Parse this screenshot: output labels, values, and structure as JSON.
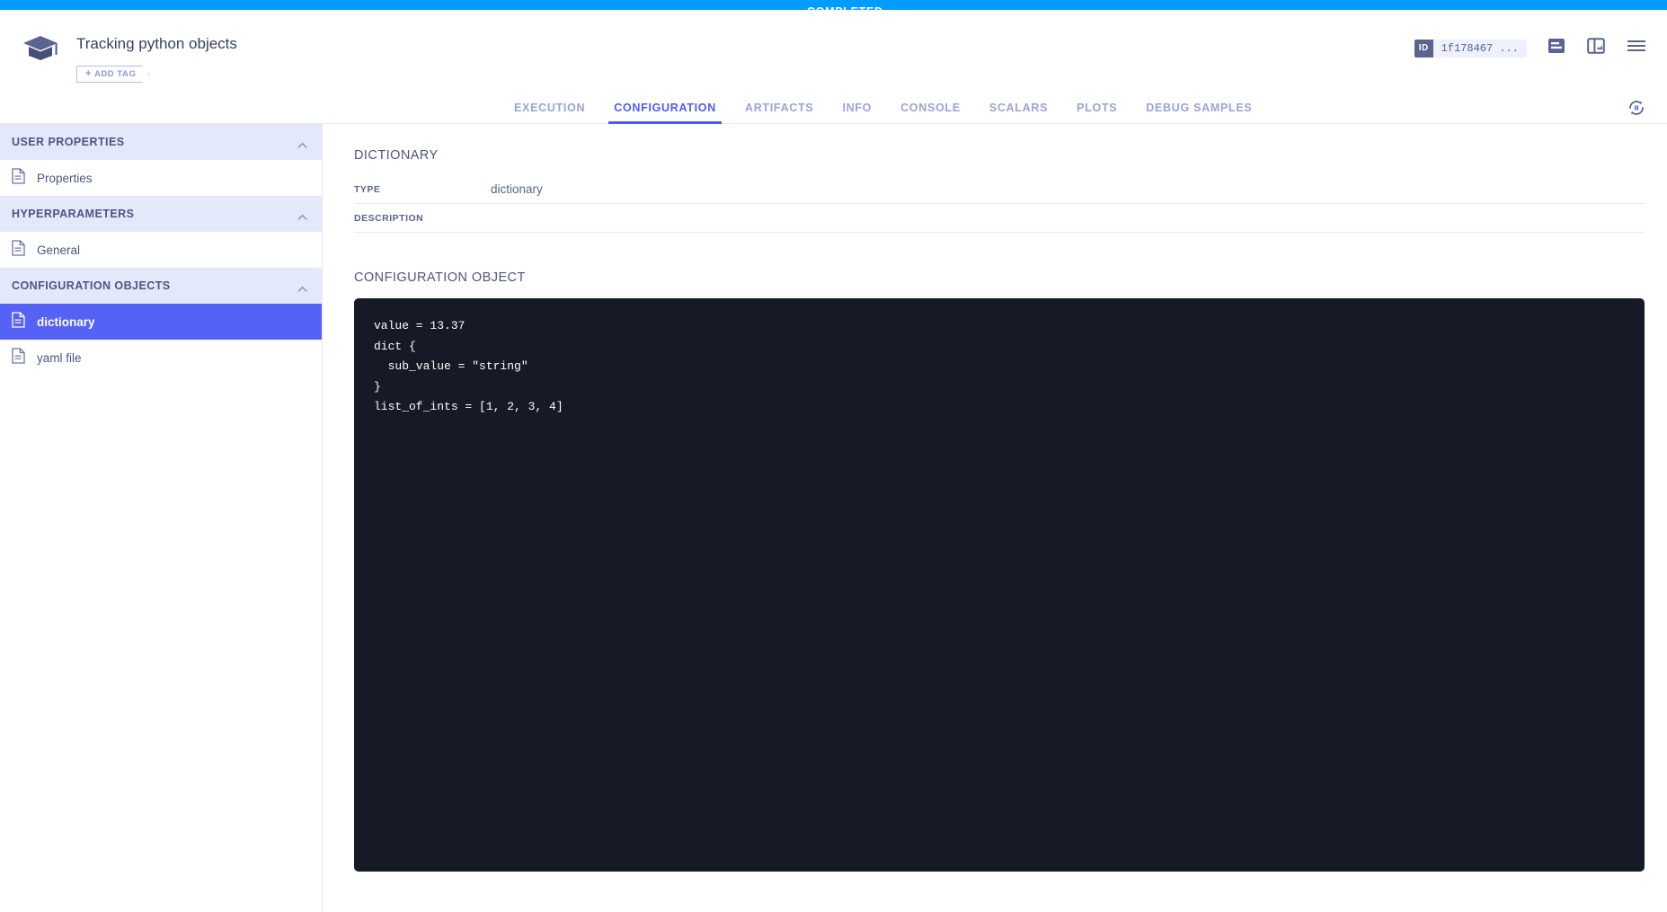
{
  "status": {
    "label": "COMPLETED",
    "color": "#009dff"
  },
  "header": {
    "title": "Tracking python objects",
    "add_tag_label": "ADD TAG",
    "add_tag_plus": "+",
    "logo_icon": "graduation-cap-icon",
    "id_label": "ID",
    "id_value": "1f178467 ...",
    "icons": {
      "details_view": "details-view-icon",
      "split_view": "split-view-icon",
      "menu": "hamburger-menu-icon"
    }
  },
  "tabs": {
    "items": [
      {
        "label": "EXECUTION",
        "active": false
      },
      {
        "label": "CONFIGURATION",
        "active": true
      },
      {
        "label": "ARTIFACTS",
        "active": false
      },
      {
        "label": "INFO",
        "active": false
      },
      {
        "label": "CONSOLE",
        "active": false
      },
      {
        "label": "SCALARS",
        "active": false
      },
      {
        "label": "PLOTS",
        "active": false
      },
      {
        "label": "DEBUG SAMPLES",
        "active": false
      }
    ],
    "refresh_icon": "auto-refresh-pause-icon",
    "active_color": "#4b5bff"
  },
  "sidebar": {
    "sections": [
      {
        "title": "USER PROPERTIES",
        "items": [
          {
            "label": "Properties",
            "selected": false
          }
        ]
      },
      {
        "title": "HYPERPARAMETERS",
        "items": [
          {
            "label": "General",
            "selected": false
          }
        ]
      },
      {
        "title": "CONFIGURATION OBJECTS",
        "items": [
          {
            "label": "dictionary",
            "selected": true
          },
          {
            "label": "yaml file",
            "selected": false
          }
        ]
      }
    ],
    "selected_color": "#5562f6",
    "section_bg": "#e4e8fb"
  },
  "main": {
    "object_title": "DICTIONARY",
    "type_label": "TYPE",
    "type_value": "dictionary",
    "description_label": "DESCRIPTION",
    "description_value": "",
    "config_object_label": "CONFIGURATION OBJECT",
    "config_object_code": "value = 13.37\ndict {\n  sub_value = \"string\"\n}\nlist_of_ints = [1, 2, 3, 4]",
    "code_bg": "#161a26"
  }
}
